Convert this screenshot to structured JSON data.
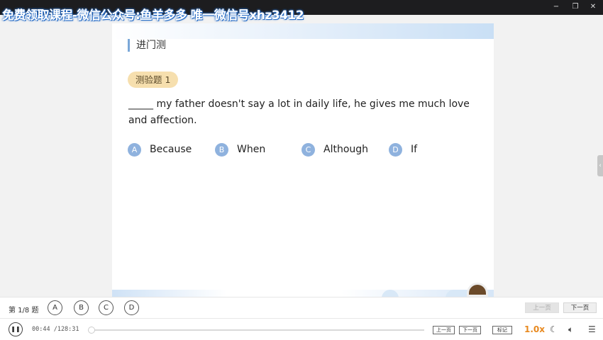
{
  "window": {
    "watermark": "免费领取课程-微信公众号:鱼羊多多 唯一微信号xhz3412",
    "controls": [
      "−",
      "❐",
      "✕"
    ]
  },
  "quiz": {
    "section_title": "进门测",
    "badge": "测验题 1",
    "question": "_____ my father doesn't say a lot in daily life, he gives me much love and affection.",
    "options": [
      {
        "letter": "A",
        "text": "Because"
      },
      {
        "letter": "B",
        "text": "When"
      },
      {
        "letter": "C",
        "text": "Although"
      },
      {
        "letter": "D",
        "text": "If"
      }
    ]
  },
  "answer_bar": {
    "count_label": "第 1/8 题",
    "choices": [
      "A",
      "B",
      "C",
      "D"
    ],
    "prev_label": "上一页",
    "next_label": "下一页"
  },
  "player": {
    "time": "00:44 /128:31",
    "progress_fraction": 0.0057,
    "prev_page": "上一页",
    "next_page": "下一页",
    "mark_label": "标记",
    "speed": "1.0x",
    "icons": [
      "pause-icon",
      "moon-icon",
      "volume-icon",
      "menu-icon"
    ]
  },
  "colors": {
    "accent_orange": "#f08a24",
    "option_blue": "#8fb2de",
    "badge_bg": "#f6dfae"
  }
}
